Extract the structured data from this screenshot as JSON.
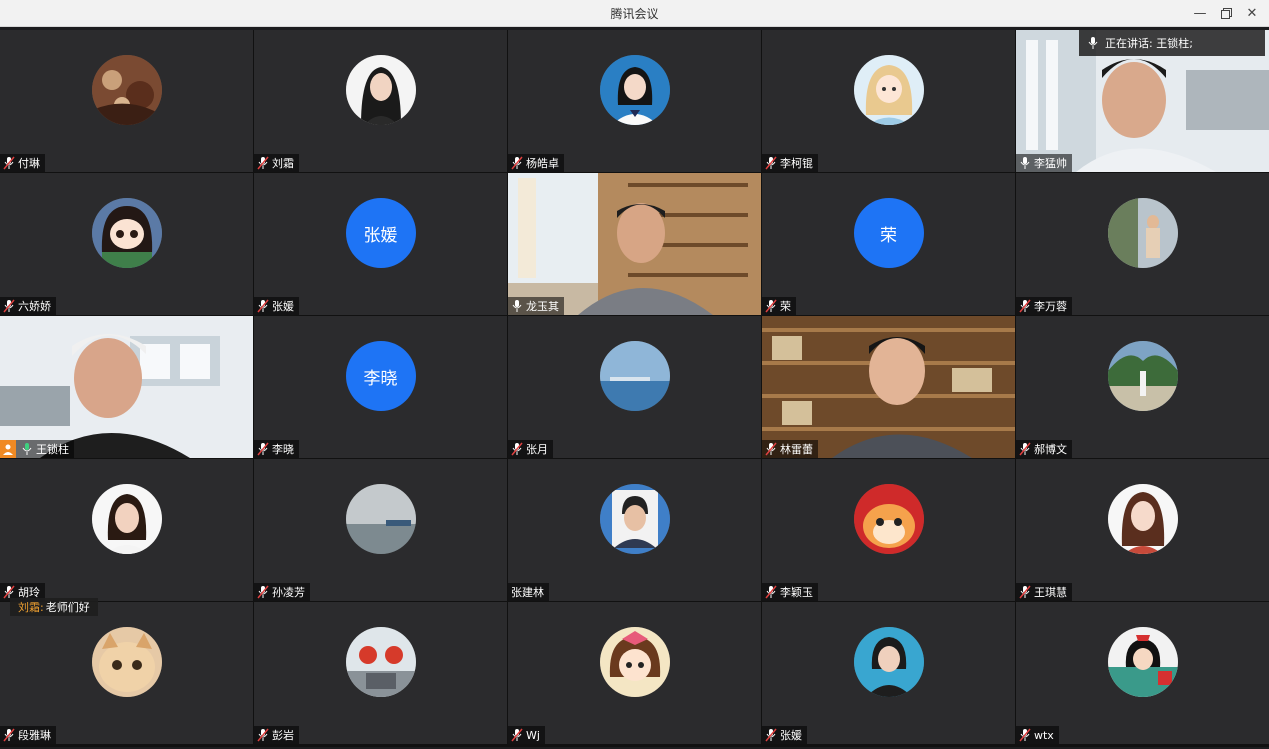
{
  "window": {
    "title": "腾讯会议",
    "minimize_icon": "minimize-icon",
    "restore_icon": "restore-icon",
    "close_icon": "close-icon"
  },
  "speaking": {
    "label": "正在讲话: 王锁柱;"
  },
  "chat": {
    "sender": "刘霜:",
    "message": "老师们好"
  },
  "participants": [
    {
      "name": "付琳",
      "type": "avatar"
    },
    {
      "name": "刘霜",
      "type": "avatar"
    },
    {
      "name": "杨皓卓",
      "type": "avatar"
    },
    {
      "name": "李柯锟",
      "type": "avatar"
    },
    {
      "name": "李猛帅",
      "type": "video"
    },
    {
      "name": "六娇娇",
      "type": "avatar"
    },
    {
      "name": "张媛",
      "type": "initials",
      "initials": "张媛"
    },
    {
      "name": "龙玉其",
      "type": "video"
    },
    {
      "name": "荣",
      "type": "initials",
      "initials": "荣"
    },
    {
      "name": "李万蓉",
      "type": "avatar"
    },
    {
      "name": "王锁柱",
      "type": "video",
      "host": true
    },
    {
      "name": "李晓",
      "type": "initials",
      "initials": "李晓"
    },
    {
      "name": "张月",
      "type": "avatar"
    },
    {
      "name": "林雷蕾",
      "type": "video"
    },
    {
      "name": "郝博文",
      "type": "avatar"
    },
    {
      "name": "胡玲",
      "type": "avatar"
    },
    {
      "name": "孙凌芳",
      "type": "avatar"
    },
    {
      "name": "张建林",
      "type": "avatar"
    },
    {
      "name": "李颖玉",
      "type": "avatar"
    },
    {
      "name": "王琪慧",
      "type": "avatar"
    },
    {
      "name": "段雅琳",
      "type": "avatar"
    },
    {
      "name": "彭岩",
      "type": "avatar"
    },
    {
      "name": "Wj",
      "type": "avatar"
    },
    {
      "name": "张媛",
      "type": "avatar"
    },
    {
      "name": "wtx",
      "type": "avatar"
    }
  ],
  "colors": {
    "accent": "#1e74f5",
    "host": "#f08a24",
    "active_border": "#3fbf7f"
  }
}
